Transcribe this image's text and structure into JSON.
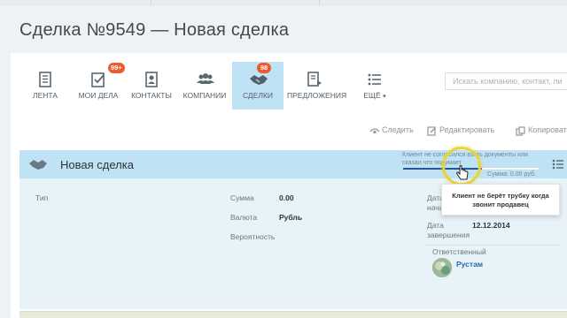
{
  "page_title": "Сделка №9549 — Новая сделка",
  "nav": {
    "items": [
      {
        "label": "ЛЕНТА",
        "icon": "feed-icon",
        "badge": null,
        "active": false
      },
      {
        "label": "МОИ ДЕЛА",
        "icon": "tasks-icon",
        "badge": "99+",
        "active": false
      },
      {
        "label": "КОНТАКТЫ",
        "icon": "contacts-icon",
        "badge": null,
        "active": false
      },
      {
        "label": "КОМПАНИИ",
        "icon": "companies-icon",
        "badge": null,
        "active": false
      },
      {
        "label": "СДЕЛКИ",
        "icon": "deals-icon",
        "badge": "98",
        "active": true
      },
      {
        "label": "ПРЕДЛОЖЕНИЯ",
        "icon": "proposals-icon",
        "badge": null,
        "active": false
      },
      {
        "label": "ЕЩЁ",
        "icon": "more-list-icon",
        "badge": null,
        "active": false
      }
    ]
  },
  "search": {
    "placeholder": "Искать компанию, контакт, ли"
  },
  "actions": {
    "follow": "Следить",
    "edit": "Редактировать",
    "copy": "Копировать"
  },
  "deal": {
    "name": "Новая сделка",
    "stage_text": "Клиент не согласился взять документы или сказал что подумает",
    "sum_text": "Сумма: 0.00 руб.",
    "progress": 0.58,
    "tooltip": "Клиент не берёт трубку когда звонит продавец"
  },
  "fields": {
    "type_label": "Тип",
    "sum_label": "Сумма",
    "sum_value": "0.00",
    "currency_label": "Валюта",
    "currency_value": "Рубль",
    "probability_label": "Вероятность",
    "start_label_1": "Дата",
    "start_label_2": "нача",
    "end_label_1": "Дата",
    "end_label_2": "завершения",
    "end_value": "12.12.2014",
    "responsible_label": "Ответственный",
    "responsible_name": "Рустам"
  },
  "colors": {
    "accent": "#bfe3f4",
    "details_bg": "#e7f3f9",
    "badge": "#f0592d",
    "progress": "#1e5ba0",
    "link": "#2d6aa8"
  }
}
